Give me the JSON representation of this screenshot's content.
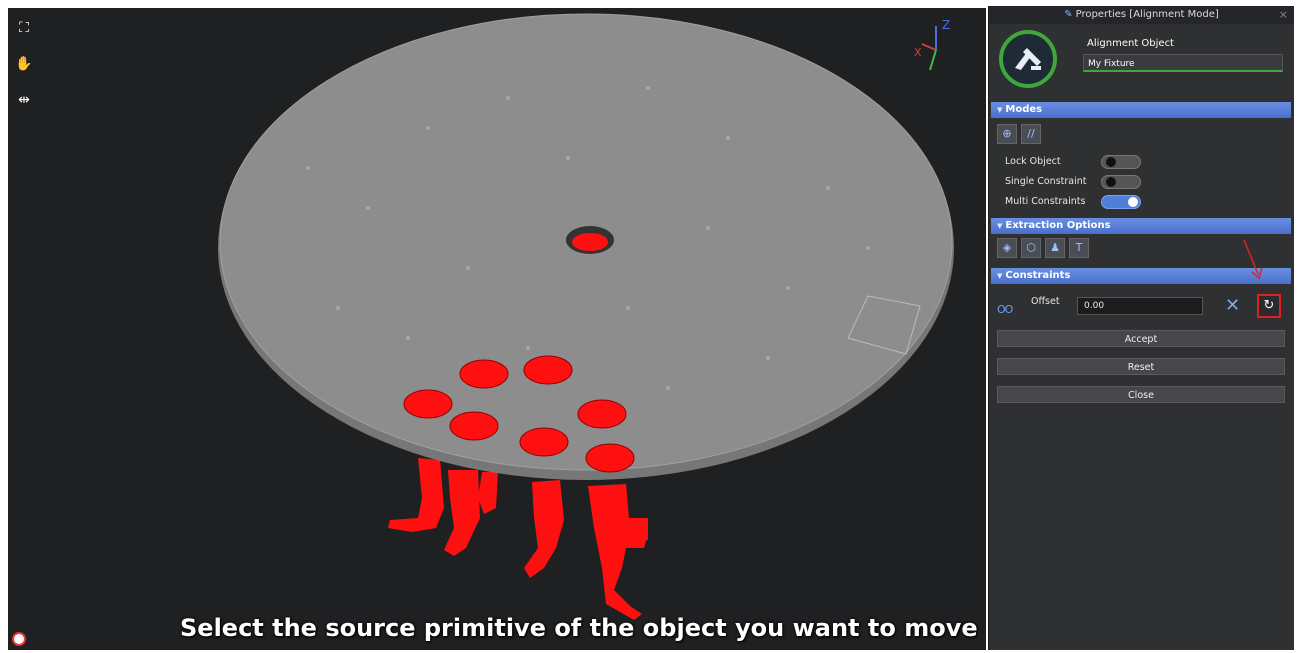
{
  "viewport": {
    "tools": [
      {
        "name": "fullscreen-icon",
        "glyph": "⛶"
      },
      {
        "name": "hand-icon",
        "glyph": "✋"
      },
      {
        "name": "fit-icon",
        "glyph": "⇹"
      }
    ],
    "axis": {
      "z": "Z",
      "x": "X"
    },
    "subtitle": "Select the source primitive of the object you want to move"
  },
  "panel": {
    "title": "Properties [Alignment Mode]",
    "close_glyph": "×",
    "object_label": "Alignment Object",
    "object_name": "My Fixture",
    "sections": {
      "modes": "Modes",
      "extraction": "Extraction Options",
      "constraints": "Constraints"
    },
    "modes": {
      "buttons": [
        {
          "name": "target-icon",
          "glyph": "⊕"
        },
        {
          "name": "parallel-icon",
          "glyph": "//"
        }
      ],
      "toggles": [
        {
          "label": "Lock Object",
          "on": false
        },
        {
          "label": "Single Constraint",
          "on": false
        },
        {
          "label": "Multi Constraints",
          "on": true
        }
      ]
    },
    "extraction": {
      "buttons": [
        {
          "name": "solid-cube-icon",
          "glyph": "◈"
        },
        {
          "name": "wire-cube-icon",
          "glyph": "⬡"
        },
        {
          "name": "figure-icon",
          "glyph": "♟"
        },
        {
          "name": "text-icon",
          "glyph": "T"
        }
      ]
    },
    "constraints": {
      "icon": "OO",
      "offset_label": "Offset",
      "offset_value": "0.00",
      "delete_glyph": "✕",
      "refresh_glyph": "↻"
    },
    "buttons": {
      "accept": "Accept",
      "reset": "Reset",
      "close": "Close"
    }
  },
  "colors": {
    "section_blue": "#5a7fd8",
    "accent_green": "#3ea63a",
    "highlight_red": "#e02020",
    "part_red": "#ff1010"
  }
}
